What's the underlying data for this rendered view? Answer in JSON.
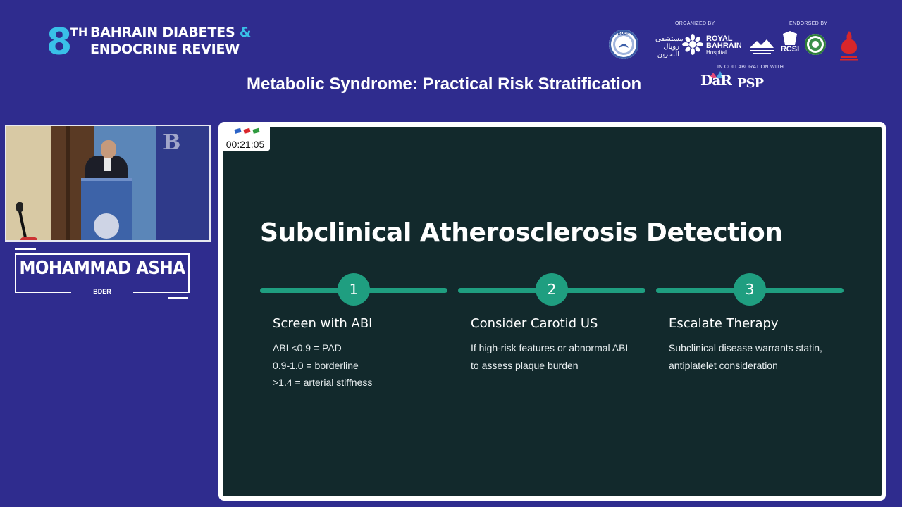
{
  "event": {
    "number": "8",
    "superscript": "TH",
    "line1_a": "BAHRAIN DIABETES",
    "line1_amp": "&",
    "line2": "ENDOCRINE REVIEW"
  },
  "session_title": "Metabolic Syndrome: Practical Risk Stratification",
  "sponsors": {
    "organized_by_label": "ORGANIZED BY",
    "endorsed_by_label": "ENDORSED BY",
    "collaboration_label": "IN COLLABORATION WITH",
    "bder_seal": "BDER",
    "royal_bahrain_arabic": "مستشفى رويال البحرين",
    "royal_bahrain_line1": "ROYAL",
    "royal_bahrain_line2": "BAHRAIN",
    "royal_bahrain_line3": "Hospital",
    "rcsi": "RCSI",
    "dar": "DaR",
    "psp": "PSP"
  },
  "speaker": {
    "name": "MOHAMMAD ASHA",
    "organization": "BDER"
  },
  "timer": {
    "value": "00:21:05"
  },
  "slide": {
    "title": "Subclinical Atherosclerosis Detection",
    "steps": [
      {
        "number": "1",
        "heading": "Screen with ABI",
        "lines": [
          "ABI <0.9 = PAD",
          "0.9-1.0 = borderline",
          ">1.4 = arterial stiffness"
        ]
      },
      {
        "number": "2",
        "heading": "Consider Carotid US",
        "lines": [
          "If high-risk features or abnormal ABI",
          "to assess plaque burden"
        ]
      },
      {
        "number": "3",
        "heading": "Escalate Therapy",
        "lines": [
          "Subclinical disease warrants statin,",
          "antiplatelet consideration"
        ]
      }
    ]
  },
  "colors": {
    "background": "#2f2c8e",
    "slide_bg": "#12292c",
    "accent_teal": "#1f9e80",
    "event_blue": "#39c0e8"
  }
}
